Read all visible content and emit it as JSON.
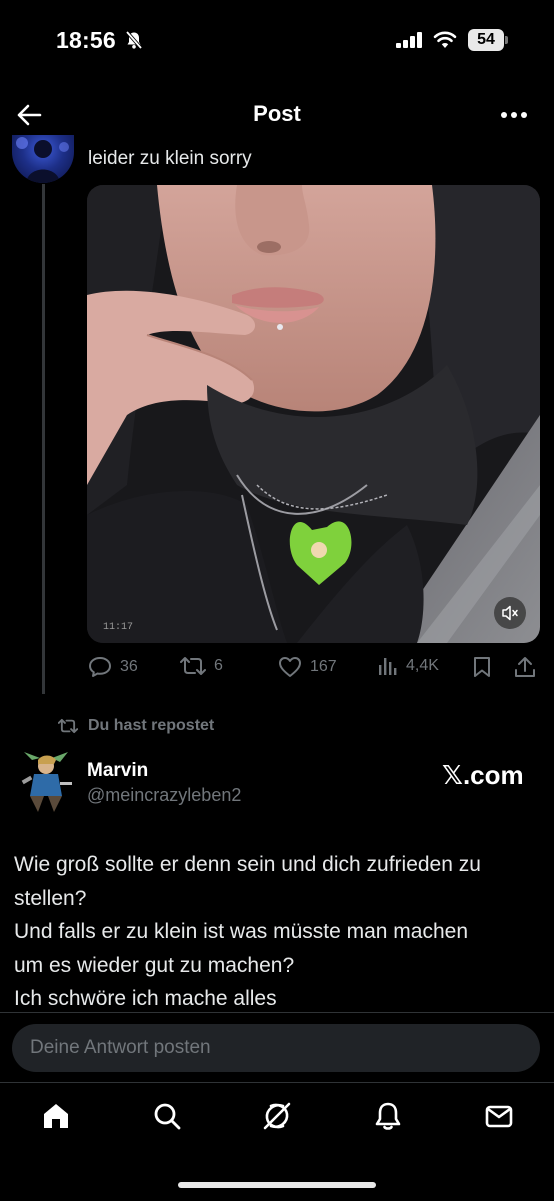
{
  "status_bar": {
    "time": "18:56",
    "battery": "54"
  },
  "header": {
    "title": "Post"
  },
  "thread_post": {
    "text": "leider zu klein sorry",
    "video_timestamp": "11:17",
    "stats": {
      "replies": "36",
      "reposts": "6",
      "likes": "167",
      "views": "4,4K"
    }
  },
  "repost_banner": {
    "text": "Du hast repostet"
  },
  "main_post": {
    "author_name": "Marvin",
    "author_handle": "@meincrazyleben2",
    "source_mark": "𝕏.com",
    "lines": [
      "Wie groß sollte er denn sein und dich zufrieden zu",
      "stellen?",
      "Und falls er zu klein ist was müsste man machen",
      "um es wieder gut zu machen?",
      "Ich schwöre ich mache alles"
    ]
  },
  "reply_input": {
    "placeholder": "Deine Antwort posten"
  },
  "tabbar": {
    "icons": [
      "home-icon",
      "search-icon",
      "grok-icon",
      "notifications-icon",
      "messages-icon"
    ]
  },
  "colors": {
    "background": "#000000",
    "muted": "#71767b",
    "text": "#e7e9ea"
  }
}
